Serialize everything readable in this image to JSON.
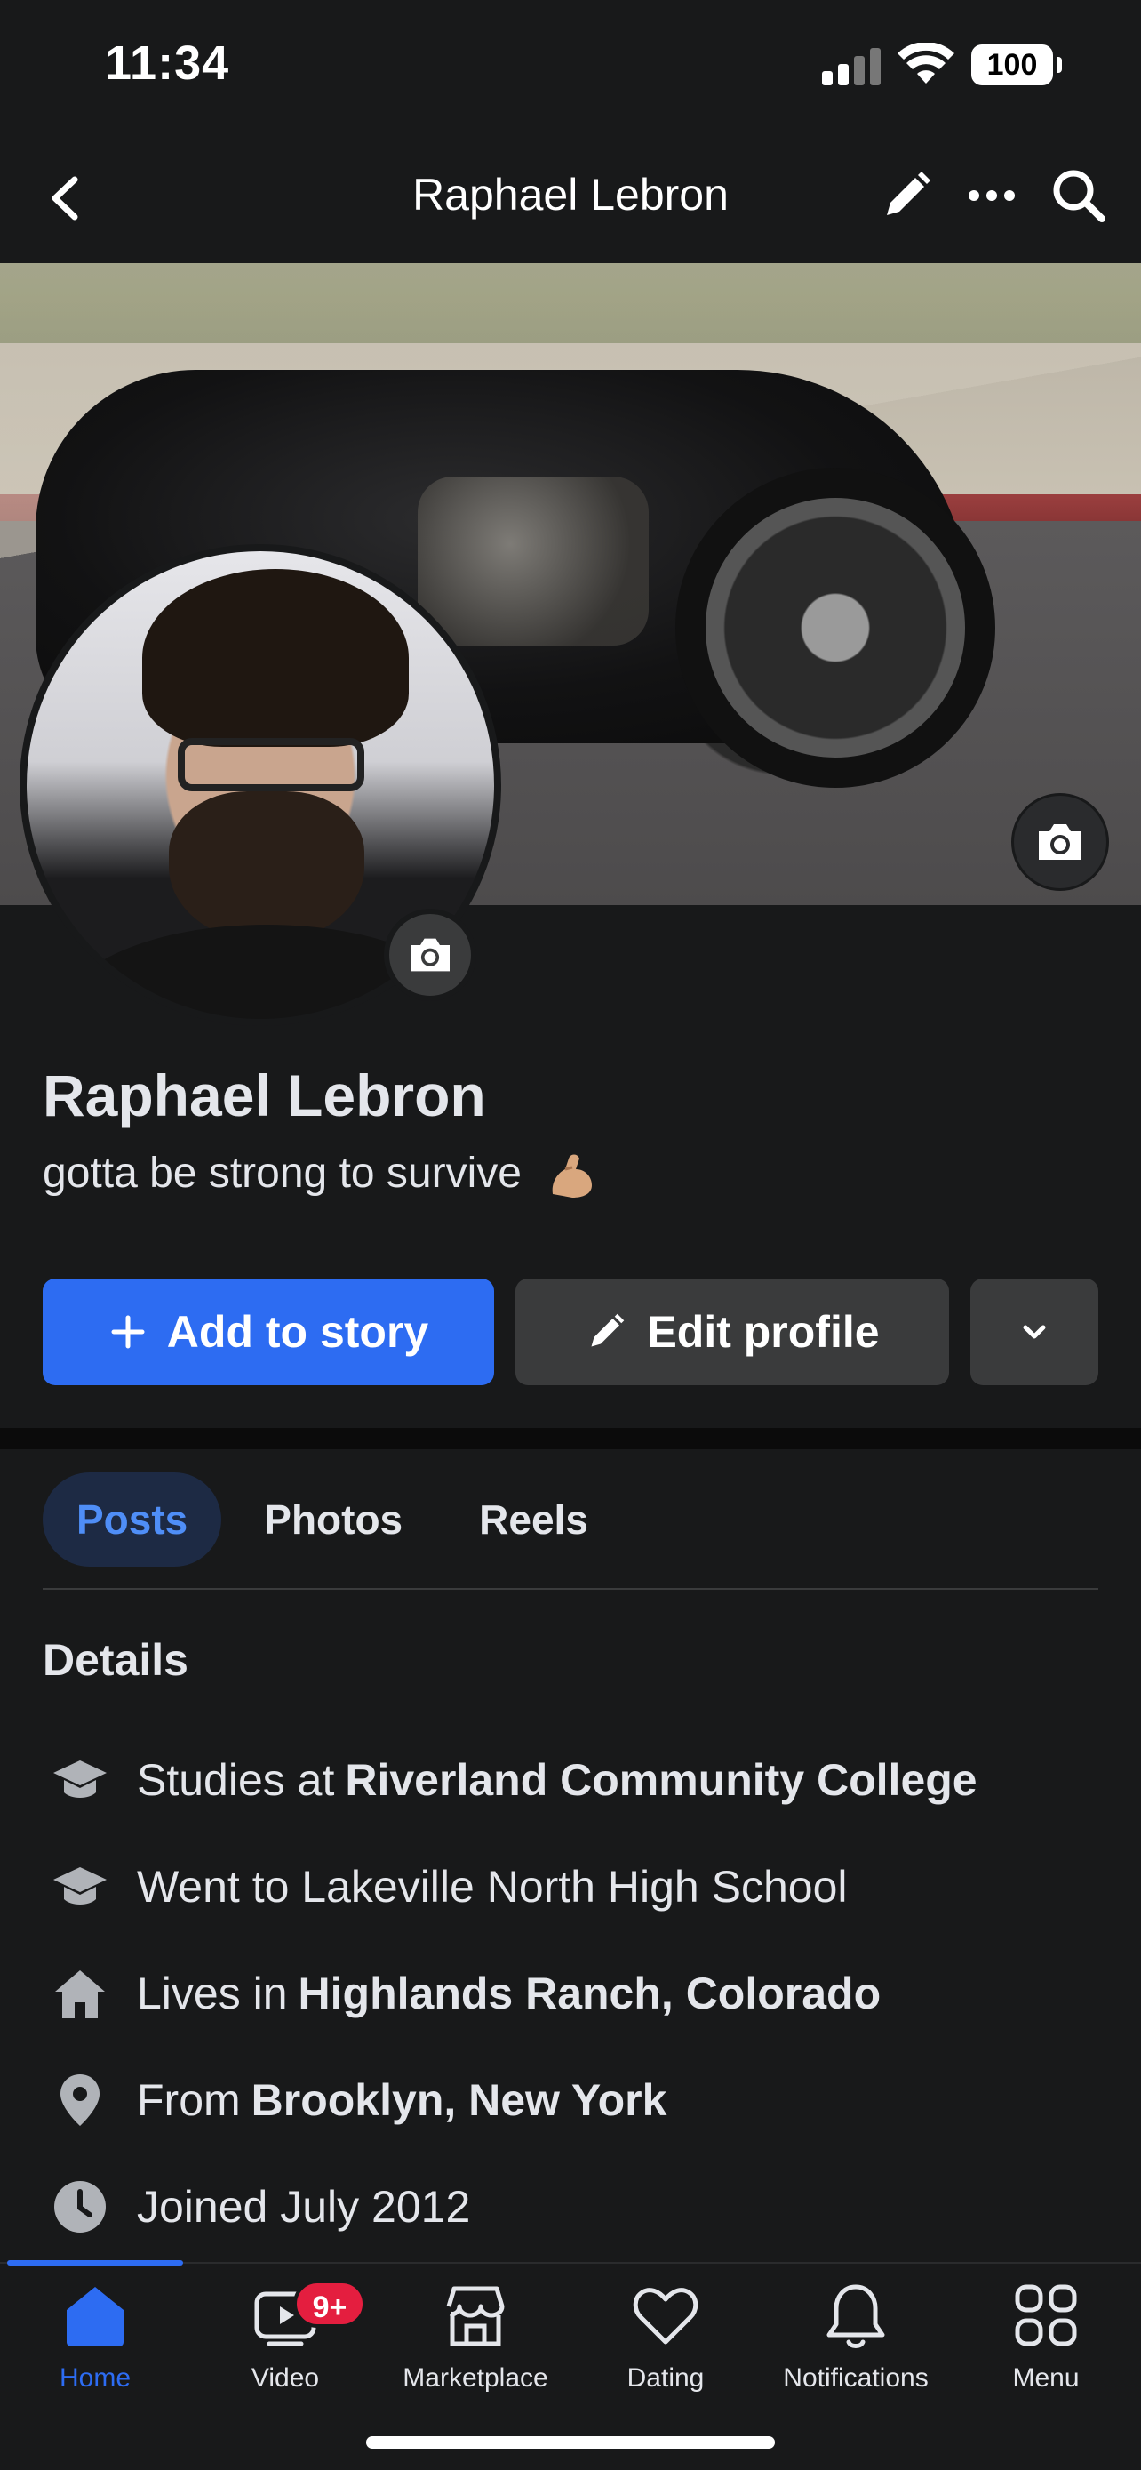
{
  "status_bar": {
    "time": "11:34",
    "battery": "100"
  },
  "header": {
    "title": "Raphael Lebron"
  },
  "profile": {
    "name": "Raphael Lebron",
    "bio": "gotta be strong to survive",
    "bio_emoji": "flexed-biceps-icon"
  },
  "actions": {
    "add_story": "Add to story",
    "edit_profile": "Edit profile"
  },
  "tabs": [
    {
      "label": "Posts",
      "active": true
    },
    {
      "label": "Photos",
      "active": false
    },
    {
      "label": "Reels",
      "active": false
    }
  ],
  "details": {
    "title": "Details",
    "items": [
      {
        "icon": "graduation-cap-icon",
        "prefix": "Studies at",
        "bold": "Riverland Community College"
      },
      {
        "icon": "graduation-cap-icon",
        "prefix": "Went to Lakeville North High School",
        "bold": ""
      },
      {
        "icon": "home-icon",
        "prefix": "Lives in",
        "bold": "Highlands Ranch, Colorado"
      },
      {
        "icon": "location-pin-icon",
        "prefix": "From",
        "bold": "Brooklyn, New York"
      },
      {
        "icon": "clock-icon",
        "prefix": "Joined July 2012",
        "bold": ""
      }
    ]
  },
  "bottom_nav": [
    {
      "label": "Home",
      "icon": "home-icon",
      "active": true
    },
    {
      "label": "Video",
      "icon": "video-icon",
      "badge": "9+"
    },
    {
      "label": "Marketplace",
      "icon": "marketplace-icon"
    },
    {
      "label": "Dating",
      "icon": "dating-heart-icon"
    },
    {
      "label": "Notifications",
      "icon": "bell-icon"
    },
    {
      "label": "Menu",
      "icon": "menu-grid-icon"
    }
  ],
  "colors": {
    "background": "#18191a",
    "accent": "#2d6cf2",
    "secondary_button": "#3a3b3c",
    "badge": "#e41e3f"
  }
}
